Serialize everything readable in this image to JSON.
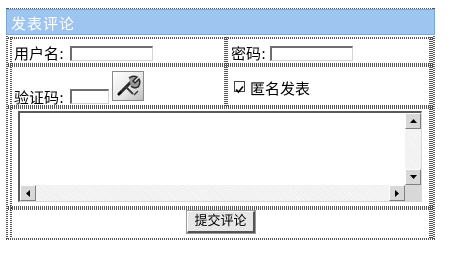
{
  "form": {
    "title": "发表评论",
    "username_label": "用户名:",
    "username_value": "",
    "password_label": "密码:",
    "password_value": "",
    "captcha_label": "验证码:",
    "captcha_value": "",
    "captcha_icon": "captcha-refresh-icon",
    "anonymous_label": "匿名发表",
    "anonymous_checked": true,
    "comment_value": "",
    "submit_label": "提交评论"
  },
  "colors": {
    "title_bar": "#9ec4f0",
    "title_text": "#ffffff",
    "dotted_border": "#555555"
  }
}
